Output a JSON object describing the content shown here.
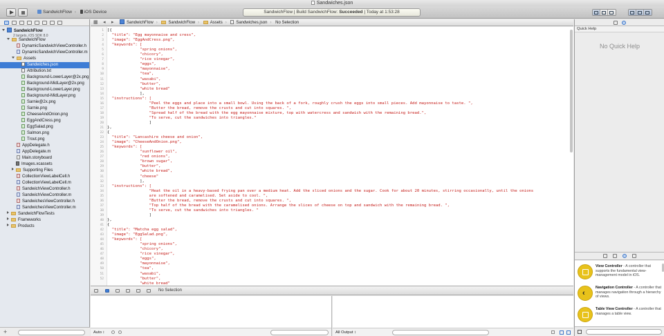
{
  "window": {
    "title": "Sandwiches.json"
  },
  "toolbar": {
    "scheme": "SandwichFlow",
    "device": "iOS Device",
    "activity_prefix": "SandwichFlow  |  Build SandwichFlow: ",
    "activity_status": "Succeeded",
    "activity_time": "  |  Today at 1:53:28"
  },
  "navigator": {
    "project_name": "SandwichFlow",
    "project_sub": "2 targets, iOS SDK 8.0",
    "items": [
      "SandwichFlow",
      "DynamicSandwichViewController.h",
      "DynamicSandwichViewController.m",
      "Assets",
      "Sandwiches.json",
      "Attribution.txt",
      "Background-LowerLayer@2x.png",
      "Background-MidLayer@2x.png",
      "Background-LowerLayer.png",
      "Background-MidLayer.png",
      "Sarnie@2x.png",
      "Sarnie.png",
      "CheeseAndOnion.png",
      "EggAndCress.png",
      "EggSalad.png",
      "Salmon.png",
      "Trout.png",
      "AppDelegate.h",
      "AppDelegate.m",
      "Main.storyboard",
      "Images.xcassets",
      "Supporting Files",
      "CollectionViewLabelCell.h",
      "CollectionViewLabelCell.m",
      "SandwichViewController.h",
      "SandwichViewController.m",
      "SandwichesViewController.h",
      "SandwichesViewController.m",
      "SandwichFlowTests",
      "Frameworks",
      "Products"
    ]
  },
  "jumpbar": {
    "crumbs": [
      "SandwichFlow",
      "SandwichFlow",
      "Assets",
      "Sandwiches.json",
      "No Selection"
    ]
  },
  "editor": {
    "line_numbers": [
      "1",
      "2",
      "3",
      "4",
      "5",
      "6",
      "7",
      "8",
      "9",
      "10",
      "11",
      "12",
      "13",
      "14",
      "15",
      "16",
      "17",
      "18",
      "19",
      "20",
      "21",
      "22",
      "23",
      "24",
      "25",
      "26",
      "27",
      "28",
      "29",
      "30",
      "31",
      "32",
      "33",
      "34",
      "35",
      "36",
      "37",
      "38",
      "39",
      "40",
      "41",
      "42",
      "43",
      "44",
      "45",
      "46",
      "47",
      "48",
      "49",
      "50",
      "51",
      "52"
    ],
    "lines": [
      "[{",
      "  \"title\": \"Egg mayonnaise and cress\",",
      "  \"image\": \"EggAndCress.png\",",
      "  \"keywords\": [",
      "              \"spring onions\",",
      "              \"chicory\",",
      "              \"rice vinegar\",",
      "              \"eggs\",",
      "              \"mayonnaise\",",
      "              \"tea\",",
      "              \"wasabi\",",
      "              \"butter\",",
      "              \"white bread\"",
      "              ],",
      "  \"instructions\": [",
      "                  \"Peel the eggs and place into a small bowl. Using the back of a fork, roughly crush the eggs into small pieces. Add mayonnaise to taste. \",",
      "                  \"Butter the bread, remove the crusts and cut into squares. \",",
      "                  \"Spread half of the bread with the egg mayonnaise mixture, top with watercress and sandwich with the remaining bread.\",",
      "                  \"To serve, cut the sandwiches into triangles.\"",
      "                  ]",
      "},",
      "{",
      "  \"title\": \"Lancashire cheese and onion\",",
      "  \"image\": \"CheeseAndOnion.png\",",
      "  \"keywords\": [",
      "              \"sunflower oil\",",
      "              \"red onions\",",
      "              \"brown sugar\",",
      "              \"butter\",",
      "              \"white bread\",",
      "              \"cheese\"",
      "              ],",
      "  \"instructions\": [",
      "                  \"Heat the oil in a heavy-based frying pan over a medium heat. Add the sliced onions and the sugar. Cook for about 20 minutes, stirring occasionally, until the onions",
      "                  are softened and caramelised. Set aside to cool. \",",
      "                  \"Butter the bread, remove the crusts and cut into squares. \",",
      "                  \"Top half of the bread with the caramelised onions. Arrange the slices of cheese on top and sandwich with the remaining bread. \",",
      "                  \"To serve, cut the sandwiches into triangles. \"",
      "                  ]",
      "},",
      "{",
      "  \"title\": \"Matcha egg salad\",",
      "  \"image\": \"EggSalad.png\",",
      "  \"keywords\": [",
      "              \"spring onions\",",
      "              \"chicory\",",
      "              \"rice vinegar\",",
      "              \"eggs\",",
      "              \"mayonnaise\",",
      "              \"tea\",",
      "              \"wasabi\",",
      "              \"butter\",",
      "              \"white bread\"",
      "              ],"
    ]
  },
  "debug": {
    "selection": "No Selection"
  },
  "variables": {
    "scope": "Auto ↕"
  },
  "console": {
    "output": "All Output ↕"
  },
  "utilities": {
    "quick_help_title": "Quick Help",
    "quick_help_empty": "No Quick Help",
    "library": [
      {
        "name": "View Controller",
        "desc": " - A controller that supports the fundamental view-management model in iOS."
      },
      {
        "name": "Navigation Controller",
        "desc": " - A controller that manages navigation through a hierarchy of views."
      },
      {
        "name": "Table View Controller",
        "desc": " - A controller that manages a table view."
      }
    ]
  }
}
